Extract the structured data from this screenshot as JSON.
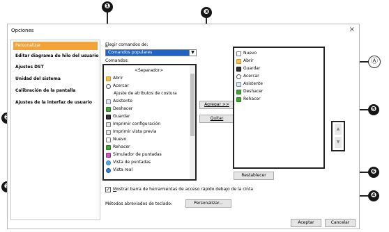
{
  "window": {
    "title": "Opciones",
    "close": "×"
  },
  "sidebar": {
    "items": [
      {
        "label": "Personalizar",
        "selected": true
      },
      {
        "label": "Editar diagrama de hilo del usuario"
      },
      {
        "label": "Ajustes DST"
      },
      {
        "label": "Unidad del sistema"
      },
      {
        "label": "Calibración de la pantalla"
      },
      {
        "label": "Ajustes de la interfaz de usuario"
      }
    ]
  },
  "category": {
    "label": "Elegir comandos de:",
    "value": "Comandos populares",
    "arrow": "▼"
  },
  "commands": {
    "label": "Comandos:",
    "items": [
      {
        "label": "<Separador>",
        "icon": "none-icon"
      },
      {
        "label": "Abrir",
        "icon": "folder-icon"
      },
      {
        "label": "Acercar",
        "icon": "zoom-in-icon"
      },
      {
        "label": "Ajuste de atributos de costura",
        "icon": "none-icon"
      },
      {
        "label": "Asistente",
        "icon": "wizard-icon"
      },
      {
        "label": "Deshacer",
        "icon": "undo-icon"
      },
      {
        "label": "Guardar",
        "icon": "save-icon"
      },
      {
        "label": "Imprimir configuración",
        "icon": "print-setup-icon"
      },
      {
        "label": "Imprimir vista previa",
        "icon": "print-preview-icon"
      },
      {
        "label": "Nuevo",
        "icon": "new-file-icon"
      },
      {
        "label": "Rehacer",
        "icon": "redo-icon"
      },
      {
        "label": "Simulador de puntadas",
        "icon": "stitch-simulator-icon"
      },
      {
        "label": "Vista de puntadas",
        "icon": "stitch-view-icon"
      },
      {
        "label": "Vista real",
        "icon": "real-view-icon"
      }
    ]
  },
  "buttons": {
    "add": "Agregar >>",
    "remove": "Quitar",
    "reset": "Restablecer",
    "customize": "Personalizar...",
    "ok": "Aceptar",
    "cancel": "Cancelar",
    "up": "▲",
    "down": "▼"
  },
  "toolbar_list": {
    "items": [
      {
        "label": "Nuevo",
        "icon": "new-file-icon"
      },
      {
        "label": "Abrir",
        "icon": "folder-icon"
      },
      {
        "label": "Guardar",
        "icon": "save-icon"
      },
      {
        "label": "Acercar",
        "icon": "zoom-in-icon"
      },
      {
        "label": "Asistente",
        "icon": "wizard-icon"
      },
      {
        "label": "Deshacer",
        "icon": "undo-icon"
      },
      {
        "label": "Rehacer",
        "icon": "redo-icon"
      }
    ]
  },
  "show_below": {
    "checked": true,
    "mark": "✓",
    "label": "Mostrar barra de herramientas de acceso rápido debajo de la cinta"
  },
  "shortcuts": {
    "label": "Métodos abreviados de teclado:"
  },
  "callouts": [
    "❶",
    "❸",
    "Ⓐ",
    "❷",
    "❺",
    "❻",
    "❼",
    "❹"
  ],
  "colors": {
    "selected_bg": "#f2a33a",
    "combo_bg": "#1e63c6",
    "callout_bg": "#151515"
  }
}
